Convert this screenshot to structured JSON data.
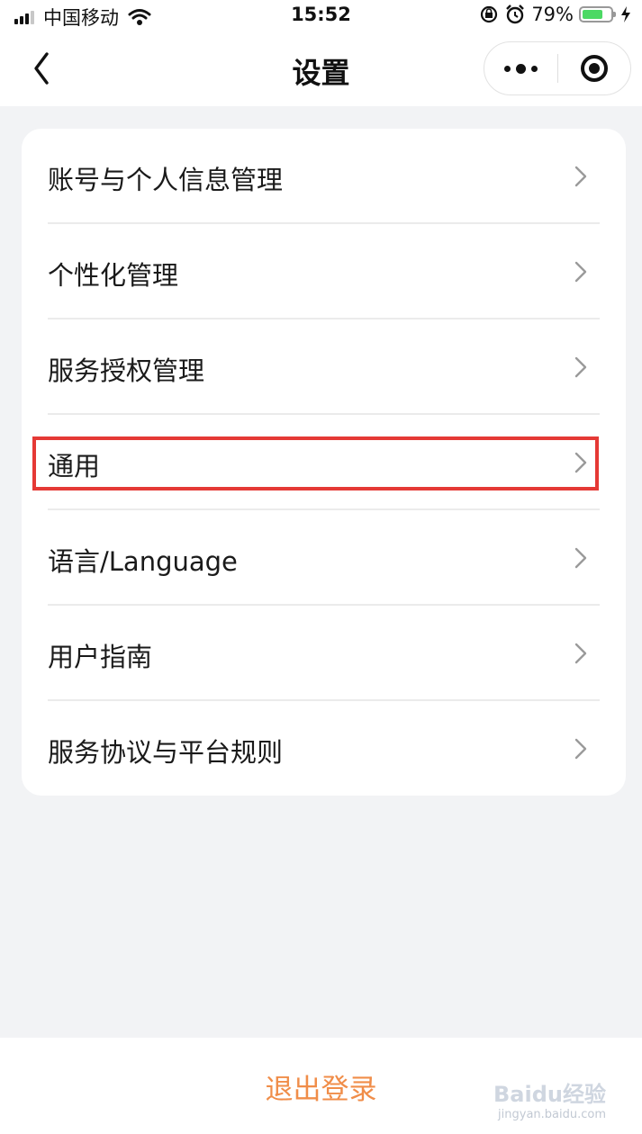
{
  "status_bar": {
    "carrier": "中国移动",
    "time": "15:52",
    "battery_percent": "79%",
    "battery_level": 0.79,
    "icons": [
      "signal-icon",
      "wifi-icon",
      "orientation-lock-icon",
      "alarm-icon",
      "battery-icon",
      "charging-icon"
    ]
  },
  "nav": {
    "title": "设置",
    "back_icon": "chevron-left-icon",
    "menu_icon": "more-dots-icon",
    "close_icon": "target-circle-icon"
  },
  "settings": {
    "items": [
      {
        "label": "账号与个人信息管理"
      },
      {
        "label": "个性化管理"
      },
      {
        "label": "服务授权管理"
      },
      {
        "label": "通用"
      },
      {
        "label": "语言/Language"
      },
      {
        "label": "用户指南"
      },
      {
        "label": "服务协议与平台规则"
      }
    ],
    "chevron_icon": "chevron-right-icon"
  },
  "highlight": {
    "target": "通用",
    "color": "#e53935"
  },
  "footer": {
    "logout_label": "退出登录",
    "logout_color": "#f08d49"
  },
  "watermark": {
    "text": "Baidu经验",
    "subtext": "jingyan.baidu.com"
  }
}
